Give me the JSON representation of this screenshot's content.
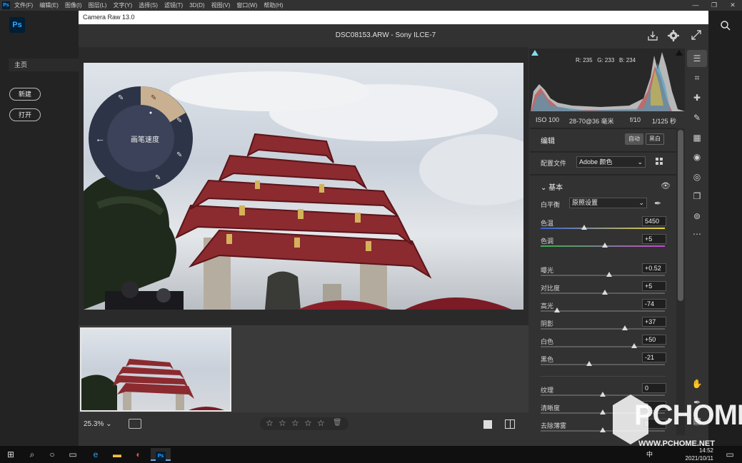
{
  "ps": {
    "menu": [
      "文件(F)",
      "编辑(E)",
      "图像(I)",
      "图层(L)",
      "文字(Y)",
      "选择(S)",
      "滤镜(T)",
      "3D(D)",
      "视图(V)",
      "窗口(W)",
      "帮助(H)"
    ],
    "logo": "Ps",
    "home_label": "主页",
    "new_button": "新建",
    "open_button": "打开",
    "win_min": "—",
    "win_max": "❐",
    "win_close": "✕"
  },
  "camera_raw": {
    "title": "Camera Raw 13.0",
    "file_title": "DSC08153.ARW - Sony ILCE-7",
    "radial_menu_label": "画笔速度",
    "zoom": "25.3%",
    "stars": [
      "☆",
      "☆",
      "☆",
      "☆",
      "☆"
    ]
  },
  "histogram": {
    "r_label": "R: 235",
    "g_label": "G: 233",
    "b_label": "B: 234"
  },
  "exif": {
    "iso": "ISO 100",
    "lens": "28-70@36 毫米",
    "aperture": "f/10",
    "shutter": "1/125 秒"
  },
  "edit": {
    "heading": "编辑",
    "auto_button": "自动",
    "bw_button": "黑白",
    "profile_label": "配置文件",
    "profile_value": "Adobe 颜色",
    "basic_heading": "基本",
    "wb_label": "白平衡",
    "wb_value": "原照设置",
    "sliders": [
      {
        "label": "色温",
        "value": "5450",
        "pos": 0.35
      },
      {
        "label": "色调",
        "value": "+5",
        "pos": 0.52
      },
      {
        "label": "曝光",
        "value": "+0.52",
        "pos": 0.55
      },
      {
        "label": "对比度",
        "value": "+5",
        "pos": 0.52
      },
      {
        "label": "高光",
        "value": "-74",
        "pos": 0.13
      },
      {
        "label": "阴影",
        "value": "+37",
        "pos": 0.68
      },
      {
        "label": "白色",
        "value": "+50",
        "pos": 0.75
      },
      {
        "label": "黑色",
        "value": "-21",
        "pos": 0.39
      },
      {
        "label": "纹理",
        "value": "0",
        "pos": 0.5
      },
      {
        "label": "清晰度",
        "value": "0",
        "pos": 0.5
      },
      {
        "label": "去除薄雾",
        "value": "0",
        "pos": 0.5
      }
    ]
  },
  "taskbar": {
    "time": "14:52",
    "date": "2021/10/11",
    "ime": "中"
  },
  "watermark": {
    "brand": "PCHOME",
    "url": "WWW.PCHOME.NET"
  }
}
